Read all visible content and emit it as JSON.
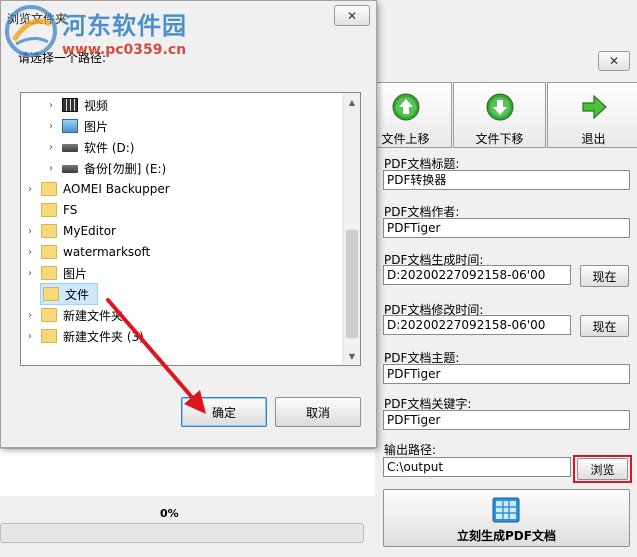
{
  "watermark": {
    "name": "河东软件园",
    "url": "www.pc0359.cn"
  },
  "dialog": {
    "title": "浏览文件夹",
    "prompt": "请选择一个路径:",
    "close_label": "✕",
    "tree_items": [
      {
        "label": "视频",
        "icon": "video-folder-icon",
        "selected": false
      },
      {
        "label": "图片",
        "icon": "picture-folder-icon",
        "selected": false
      },
      {
        "label": "软件 (D:)",
        "icon": "drive-icon",
        "selected": false
      },
      {
        "label": "备份[勿删] (E:)",
        "icon": "drive-icon",
        "selected": false
      },
      {
        "label": "AOMEI Backupper",
        "icon": "folder-icon",
        "selected": false
      },
      {
        "label": "FS",
        "icon": "folder-icon",
        "selected": false
      },
      {
        "label": "MyEditor",
        "icon": "folder-icon",
        "selected": false
      },
      {
        "label": "watermarksoft",
        "icon": "folder-icon",
        "selected": false
      },
      {
        "label": "图片",
        "icon": "folder-icon",
        "selected": false
      },
      {
        "label": "文件",
        "icon": "folder-icon",
        "selected": true
      },
      {
        "label": "新建文件夹",
        "icon": "folder-icon",
        "selected": false
      },
      {
        "label": "新建文件夹 (3)",
        "icon": "folder-icon",
        "selected": false
      }
    ],
    "ok_label": "确定",
    "cancel_label": "取消"
  },
  "app": {
    "close_label": "✕",
    "toolbar": {
      "move_up_label": "文件上移",
      "move_down_label": "文件下移",
      "exit_label": "退出"
    },
    "fields": {
      "title_label": "PDF文档标题:",
      "title_value": "PDF转换器",
      "author_label": "PDF文档作者:",
      "author_value": "PDFTiger",
      "created_label": "PDF文档生成时间:",
      "created_value": "D:20200227092158-06'00",
      "modified_label": "PDF文档修改时间:",
      "modified_value": "D:20200227092158-06'00",
      "now_label": "现在",
      "subject_label": "PDF文档主题:",
      "subject_value": "PDFTiger",
      "keywords_label": "PDF文档关键字:",
      "keywords_value": "PDFTiger",
      "output_label": "输出路径:",
      "output_value": "C:\\output",
      "browse_label": "浏览"
    },
    "generate_label": "立刻生成PDF文档",
    "progress_text": "0%",
    "progress_value": 0
  },
  "colors": {
    "highlight_box": "#e0141c",
    "arrow": "#e0141c",
    "selection": "#cce8ff"
  }
}
